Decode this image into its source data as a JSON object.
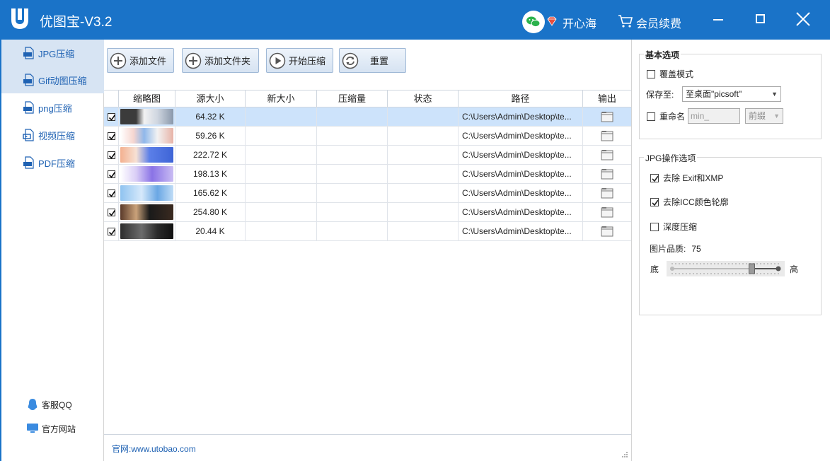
{
  "title_bar": {
    "app_title": "优图宝-V3.2",
    "username": "开心海",
    "renew_label": "会员续费",
    "accent": "#1a73c8"
  },
  "sidebar": {
    "items": [
      {
        "label": "JPG压缩",
        "icon": "jpg-file-icon",
        "active": true
      },
      {
        "label": "Gif动图压缩",
        "icon": "gif-file-icon",
        "active": true
      },
      {
        "label": "png压缩",
        "icon": "png-file-icon",
        "active": false
      },
      {
        "label": "视频压缩",
        "icon": "video-file-icon",
        "active": false
      },
      {
        "label": "PDF压缩",
        "icon": "pdf-file-icon",
        "active": false
      }
    ],
    "support_label": "客服QQ",
    "website_label": "官方网站"
  },
  "toolbar": {
    "add_file": "添加文件",
    "add_folder": "添加文件夹",
    "start": "开始压缩",
    "reset": "重置"
  },
  "table": {
    "columns": [
      "缩略图",
      "源大小",
      "新大小",
      "压缩量",
      "状态",
      "路径",
      "输出"
    ],
    "rows": [
      {
        "size": "64.32 K",
        "path": "C:\\Users\\Admin\\Desktop\\te...",
        "checked": true,
        "selected": true
      },
      {
        "size": "59.26 K",
        "path": "C:\\Users\\Admin\\Desktop\\te...",
        "checked": true,
        "selected": false
      },
      {
        "size": "222.72 K",
        "path": "C:\\Users\\Admin\\Desktop\\te...",
        "checked": true,
        "selected": false
      },
      {
        "size": "198.13 K",
        "path": "C:\\Users\\Admin\\Desktop\\te...",
        "checked": true,
        "selected": false
      },
      {
        "size": "165.62 K",
        "path": "C:\\Users\\Admin\\Desktop\\te...",
        "checked": true,
        "selected": false
      },
      {
        "size": "254.80 K",
        "path": "C:\\Users\\Admin\\Desktop\\te...",
        "checked": true,
        "selected": false
      },
      {
        "size": "20.44 K",
        "path": "C:\\Users\\Admin\\Desktop\\te...",
        "checked": true,
        "selected": false
      }
    ]
  },
  "footer": {
    "site": "官网:www.utobao.com"
  },
  "basic_options": {
    "title": "基本选项",
    "overwrite_label": "覆盖模式",
    "overwrite_checked": false,
    "save_to_label": "保存至:",
    "save_to_value": "至桌面\"picsoft\"",
    "rename_label": "重命名",
    "rename_checked": false,
    "rename_placeholder": "min_",
    "rename_position": "前缀"
  },
  "jpg_options": {
    "title": "JPG操作选项",
    "remove_exif_label": "去除 Exif和XMP",
    "remove_exif_checked": true,
    "remove_icc_label": "去除ICC颜色轮廓",
    "remove_icc_checked": true,
    "deep_label": "深度压缩",
    "deep_checked": false,
    "quality_label": "图片品质:",
    "quality_value": "75",
    "quality_fraction": 0.75,
    "low_label": "底",
    "high_label": "高"
  }
}
